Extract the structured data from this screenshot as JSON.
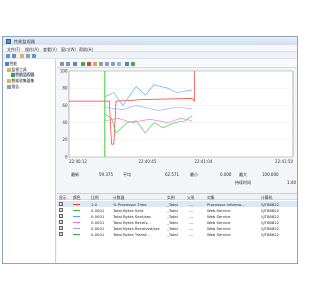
{
  "window": {
    "title": "性能监视器"
  },
  "menubar": {
    "items": [
      "文件(F)",
      "操作(A)",
      "查看(V)",
      "窗口(W)",
      "帮助(H)"
    ]
  },
  "tree": {
    "items": [
      {
        "label": "性能"
      },
      {
        "label": "监视工具"
      },
      {
        "label": "性能监视器"
      },
      {
        "label": "数据收集器集"
      },
      {
        "label": "报告"
      }
    ]
  },
  "graph": {
    "y_ticks": [
      "100",
      "80",
      "60",
      "40",
      "20",
      "0"
    ],
    "x_ticks": [
      "22:40:12",
      "22:40:45",
      "22:41:04",
      "22:41:50"
    ],
    "colors": {
      "processor": "#ff3333",
      "bytes_sent": "#33cc33",
      "bytes_sent_sec": "#44aaff",
      "bytes_recv": "#ff66cc",
      "bytes_trans": "#9999ff",
      "cursor": "#33cc33"
    }
  },
  "stats": {
    "last_label": "最新",
    "last_value": "59.375",
    "avg_label": "平均",
    "avg_value": "62.571",
    "min_label": "最小",
    "min_value": "0.000",
    "max_label": "最大",
    "max_value": "100.000",
    "duration_label": "持续时间",
    "duration_value": "1:40"
  },
  "table": {
    "headers": [
      "显示",
      "颜色",
      "比例",
      "计数器",
      "实例",
      "父系",
      "对象",
      "计算机"
    ],
    "rows": [
      {
        "scale": "1.0",
        "counter": "% Processor Time",
        "instance": "_Total",
        "parent": "---",
        "object": "Processor Informa...",
        "computer": "\\\\JT88822",
        "color": "#ff3333",
        "selected": true
      },
      {
        "scale": "0.0001",
        "counter": "Total Bytes Sent",
        "instance": "_Total",
        "parent": "---",
        "object": "Web Service",
        "computer": "\\\\JT88822",
        "color": "#33cc33",
        "selected": false
      },
      {
        "scale": "0.0001",
        "counter": "Total Bytes Sent/sec",
        "instance": "_Total",
        "parent": "---",
        "object": "Web Service",
        "computer": "\\\\JT88822",
        "color": "#44aaff",
        "selected": false
      },
      {
        "scale": "0.0001",
        "counter": "Total Bytes Receiv...",
        "instance": "_Total",
        "parent": "---",
        "object": "Web Service",
        "computer": "\\\\JT88822",
        "color": "#ff66cc",
        "selected": false
      },
      {
        "scale": "0.0001",
        "counter": "Total Bytes Received/sec",
        "instance": "_Total",
        "parent": "---",
        "object": "Web Service",
        "computer": "\\\\JT88822",
        "color": "#9999ff",
        "selected": false
      },
      {
        "scale": "0.0001",
        "counter": "Total Bytes Transf...",
        "instance": "_Total",
        "parent": "---",
        "object": "Web Service",
        "computer": "\\\\JT88822",
        "color": "#33aa55",
        "selected": false
      }
    ]
  }
}
